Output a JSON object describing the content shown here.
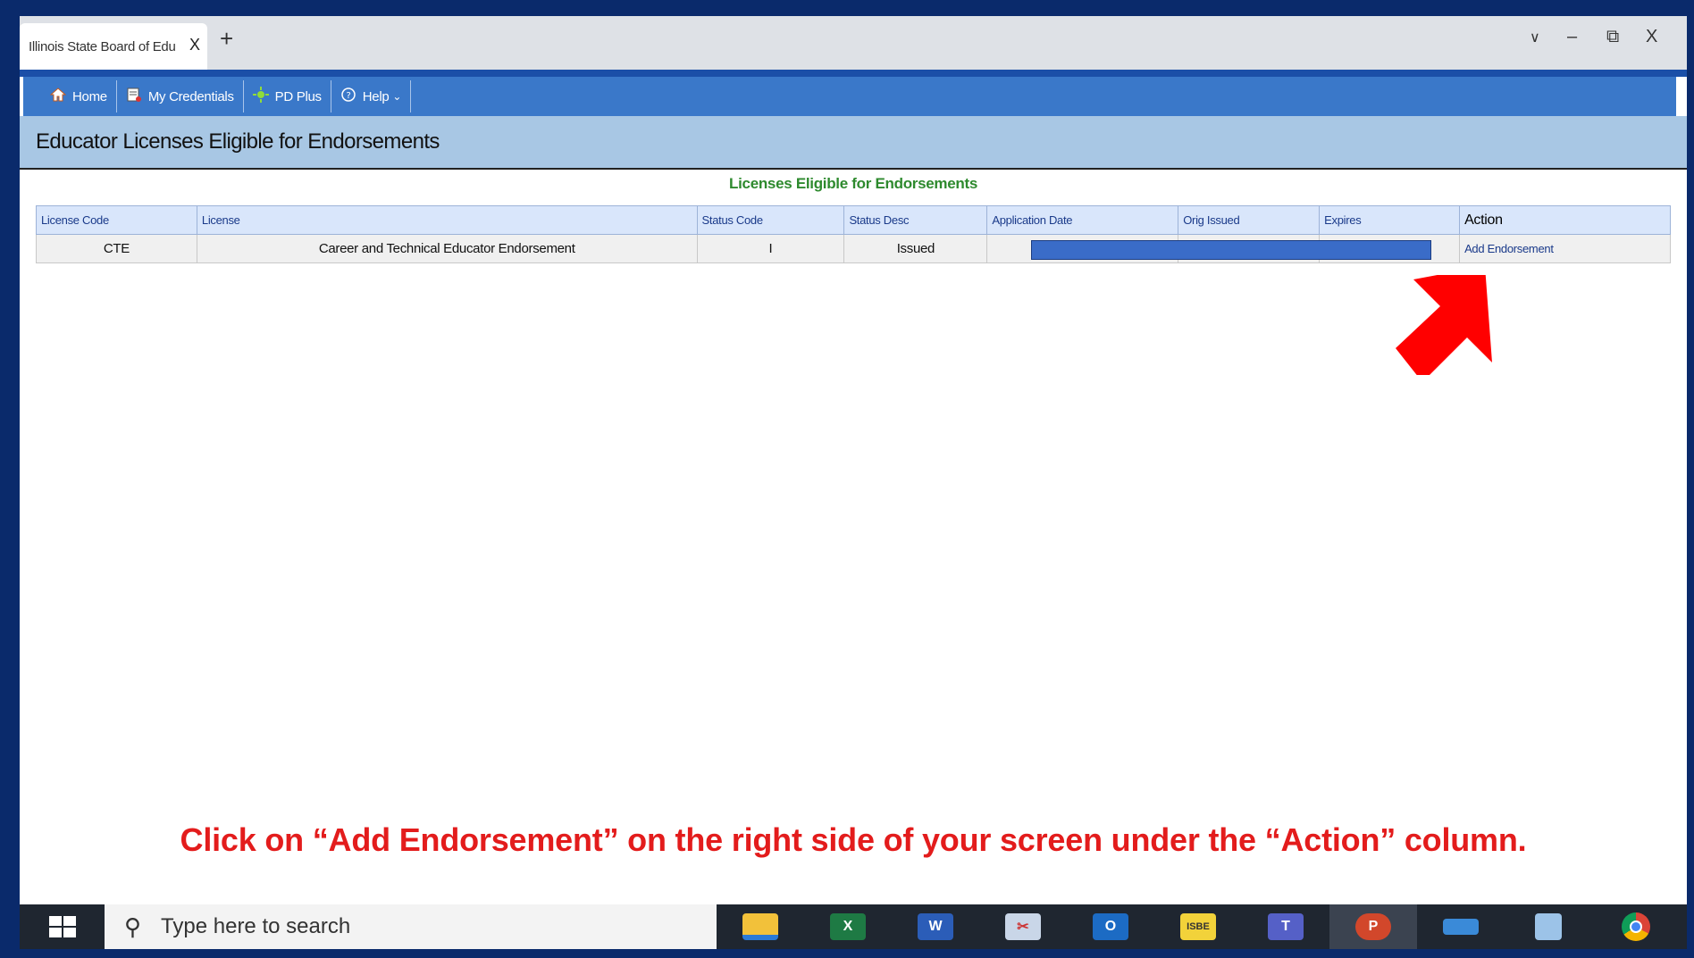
{
  "browser": {
    "tab_title": "Illinois State Board of Education",
    "tab_close": "X",
    "new_tab": "+",
    "controls": {
      "dropdown": "∨",
      "minimize": "–",
      "restore": "⧉",
      "close": "X"
    }
  },
  "nav": {
    "items": [
      {
        "label": "Home",
        "icon": "home-icon"
      },
      {
        "label": "My Credentials",
        "icon": "credentials-icon"
      },
      {
        "label": "PD Plus",
        "icon": "pd-plus-icon"
      },
      {
        "label": "Help",
        "icon": "help-icon"
      }
    ],
    "help_caret": "⌄"
  },
  "page": {
    "title": "Educator Licenses Eligible for Endorsements"
  },
  "table": {
    "caption": "Licenses Eligible for Endorsements",
    "headers": [
      "License Code",
      "License",
      "Status Code",
      "Status Desc",
      "Application Date",
      "Orig Issued",
      "Expires",
      "Action"
    ],
    "rows": [
      {
        "license_code": "CTE",
        "license": "Career and Technical Educator Endorsement",
        "status_code": "I",
        "status_desc": "Issued",
        "application_date": "",
        "orig_issued": "",
        "expires": "",
        "action": "Add Endorsement"
      }
    ]
  },
  "instruction": "Click on “Add Endorsement” on the right side of your screen under the “Action” column.",
  "taskbar": {
    "search_placeholder": "Type here to search",
    "apps": [
      "file-explorer-icon",
      "excel-icon",
      "word-icon",
      "snipping-tool-icon",
      "outlook-icon",
      "isbe-icon",
      "teams-icon",
      "powerpoint-icon",
      "remote-desktop-icon",
      "calculator-icon",
      "chrome-icon"
    ]
  },
  "colors": {
    "nav_blue": "#3a78c9",
    "header_band": "#a8c7e4",
    "caption_green": "#2e8a2e",
    "instruction_red": "#e31c1c",
    "arrow_red": "#ff0000",
    "taskbar": "#1f2630"
  }
}
